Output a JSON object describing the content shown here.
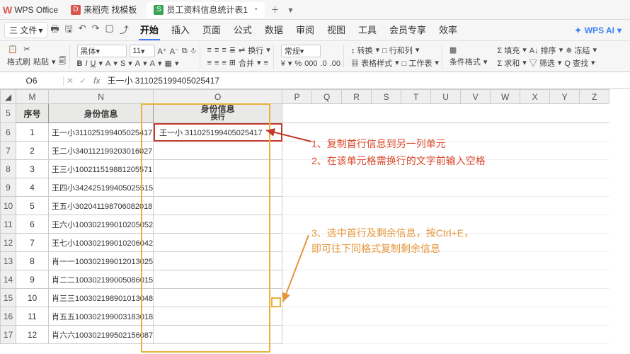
{
  "app": {
    "brand": "WPS Office"
  },
  "tabs": [
    {
      "icon_bg": "#d9534f",
      "icon_txt": "D",
      "label": "来稻壳 找模板",
      "active": false
    },
    {
      "icon_bg": "#3aa655",
      "icon_txt": "S",
      "label": "员工资料信息统计表1",
      "active": true,
      "dirty": "•"
    }
  ],
  "menu": {
    "file": "三 文件",
    "quick_icons": [
      "🖶",
      "🖫",
      "↶",
      "↷",
      "▢",
      "⤴"
    ],
    "items": [
      "开始",
      "插入",
      "页面",
      "公式",
      "数据",
      "审阅",
      "视图",
      "工具",
      "会员专享",
      "效率"
    ],
    "active": "开始",
    "ai": "WPS AI"
  },
  "ribbon": {
    "clipboard": {
      "fmt": "格式刷",
      "paste": "粘贴",
      "cut": "✂",
      "copy": "🗐"
    },
    "font": {
      "name": "黑体",
      "size": "11",
      "buttons": [
        "A⁺",
        "A⁻",
        "⧉",
        "⎀"
      ],
      "style": [
        "B",
        "I",
        "U",
        "A",
        "S",
        "A",
        "A",
        "▦"
      ]
    },
    "align": {
      "r1": [
        "≡",
        "≡",
        "≡",
        "≣",
        "⇌",
        "换行"
      ],
      "r2": [
        "≡",
        "≡",
        "≡",
        "⊞",
        "合并",
        "≡"
      ]
    },
    "number": {
      "fmt": "常规",
      "btns": [
        "¥",
        "%",
        "000",
        ".0",
        ".00"
      ]
    },
    "cell": {
      "r1": [
        "↕ 转换",
        "□ 行和列"
      ],
      "r2": [
        "▦ 表格样式",
        "□ 工作表"
      ]
    },
    "cond": "条件格式",
    "ops": {
      "r1": [
        "Σ 填充",
        "A↓ 排序",
        "❄ 冻结"
      ],
      "r2": [
        "Σ 求和",
        "▽ 筛选",
        "Q 查找"
      ]
    }
  },
  "namebox": {
    "cell": "O6",
    "formula": "王一小 311025199405025417"
  },
  "cols": [
    "M",
    "N",
    "O",
    "P",
    "Q",
    "R",
    "S",
    "T",
    "U",
    "V",
    "W",
    "X",
    "Y",
    "Z"
  ],
  "header": {
    "seq": "序号",
    "info": "身份信息",
    "info_wrap_l1": "身份信息",
    "info_wrap_l2": "换行"
  },
  "rows": [
    {
      "r": 6,
      "seq": "1",
      "n": "王一小311025199405025417",
      "o": "王一小  311025199405025417"
    },
    {
      "r": 7,
      "seq": "2",
      "n": "王二小340112199203016027",
      "o": ""
    },
    {
      "r": 8,
      "seq": "3",
      "n": "王三小100211519881205571",
      "o": ""
    },
    {
      "r": 9,
      "seq": "4",
      "n": "王四小342425199405025515",
      "o": ""
    },
    {
      "r": 10,
      "seq": "5",
      "n": "王五小302041198706082018",
      "o": ""
    },
    {
      "r": 11,
      "seq": "6",
      "n": "王六小100302199010205052",
      "o": ""
    },
    {
      "r": 12,
      "seq": "7",
      "n": "王七小100302199010206042",
      "o": ""
    },
    {
      "r": 13,
      "seq": "8",
      "n": "肖一一100302199012013025",
      "o": ""
    },
    {
      "r": 14,
      "seq": "9",
      "n": "肖二二100302199005086015",
      "o": ""
    },
    {
      "r": 15,
      "seq": "10",
      "n": "肖三三100302198901013048",
      "o": ""
    },
    {
      "r": 16,
      "seq": "11",
      "n": "肖五五100302199003183018",
      "o": ""
    },
    {
      "r": 17,
      "seq": "12",
      "n": "肖六六100302199502156087",
      "o": ""
    }
  ],
  "annotations": {
    "a1": "1、复制首行信息到另一列单元",
    "a2": "2、在该单元格需换行的文字前输入空格",
    "a3": "3、选中首行及剩余信息，按Ctrl+E，",
    "a4": "即可往下同格式复制剩余信息"
  }
}
